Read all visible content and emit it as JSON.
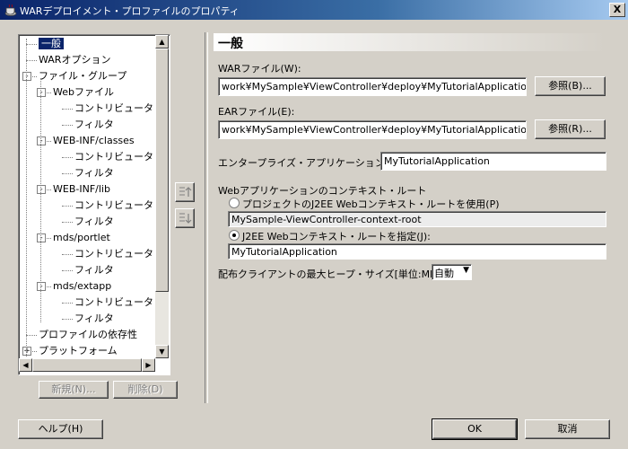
{
  "window": {
    "title": "WARデプロイメント・プロファイルのプロパティ",
    "close_label": "X"
  },
  "tree": {
    "items": [
      {
        "label": "一般",
        "level": 0,
        "expander": "",
        "selected": true
      },
      {
        "label": "WARオプション",
        "level": 0,
        "expander": ""
      },
      {
        "label": "ファイル・グループ",
        "level": 0,
        "expander": "-"
      },
      {
        "label": "Webファイル",
        "level": 1,
        "expander": "-"
      },
      {
        "label": "コントリビュータ",
        "level": 2,
        "expander": ""
      },
      {
        "label": "フィルタ",
        "level": 2,
        "expander": ""
      },
      {
        "label": "WEB-INF/classes",
        "level": 1,
        "expander": "-"
      },
      {
        "label": "コントリビュータ",
        "level": 2,
        "expander": ""
      },
      {
        "label": "フィルタ",
        "level": 2,
        "expander": ""
      },
      {
        "label": "WEB-INF/lib",
        "level": 1,
        "expander": "-"
      },
      {
        "label": "コントリビュータ",
        "level": 2,
        "expander": ""
      },
      {
        "label": "フィルタ",
        "level": 2,
        "expander": ""
      },
      {
        "label": "mds/portlet",
        "level": 1,
        "expander": "-"
      },
      {
        "label": "コントリビュータ",
        "level": 2,
        "expander": ""
      },
      {
        "label": "フィルタ",
        "level": 2,
        "expander": ""
      },
      {
        "label": "mds/extapp",
        "level": 1,
        "expander": "-"
      },
      {
        "label": "コントリビュータ",
        "level": 2,
        "expander": ""
      },
      {
        "label": "フィルタ",
        "level": 2,
        "expander": ""
      },
      {
        "label": "プロファイルの依存性",
        "level": 0,
        "expander": ""
      },
      {
        "label": "プラットフォーム",
        "level": 0,
        "expander": "+"
      }
    ]
  },
  "tree_buttons": {
    "new_label": "新規(N)...",
    "delete_label": "削除(D)"
  },
  "panel": {
    "heading": "一般",
    "war_label": "WARファイル(W):",
    "war_value": "work¥MySample¥ViewController¥deploy¥MyTutorialApplication.war",
    "browse1_label": "参照(B)...",
    "ear_label": "EARファイル(E):",
    "ear_value": "work¥MySample¥ViewController¥deploy¥MyTutorialApplication.ear",
    "browse2_label": "参照(R)...",
    "enterprise_label": "エンタープライズ・アプリケーション名(A):",
    "enterprise_value": "MyTutorialApplication",
    "context_group_label": "Webアプリケーションのコンテキスト・ルート",
    "radio1_label": "プロジェクトのJ2EE Webコンテキスト・ルートを使用(P)",
    "radio1_value": "MySample-ViewController-context-root",
    "radio2_label": "J2EE Webコンテキスト・ルートを指定(J):",
    "radio2_value": "MyTutorialApplication",
    "heap_label": "配布クライアントの最大ヒープ・サイズ[単位:MB](X):",
    "heap_value": "自動"
  },
  "footer": {
    "help_label": "ヘルプ(H)",
    "ok_label": "OK",
    "cancel_label": "取消"
  }
}
